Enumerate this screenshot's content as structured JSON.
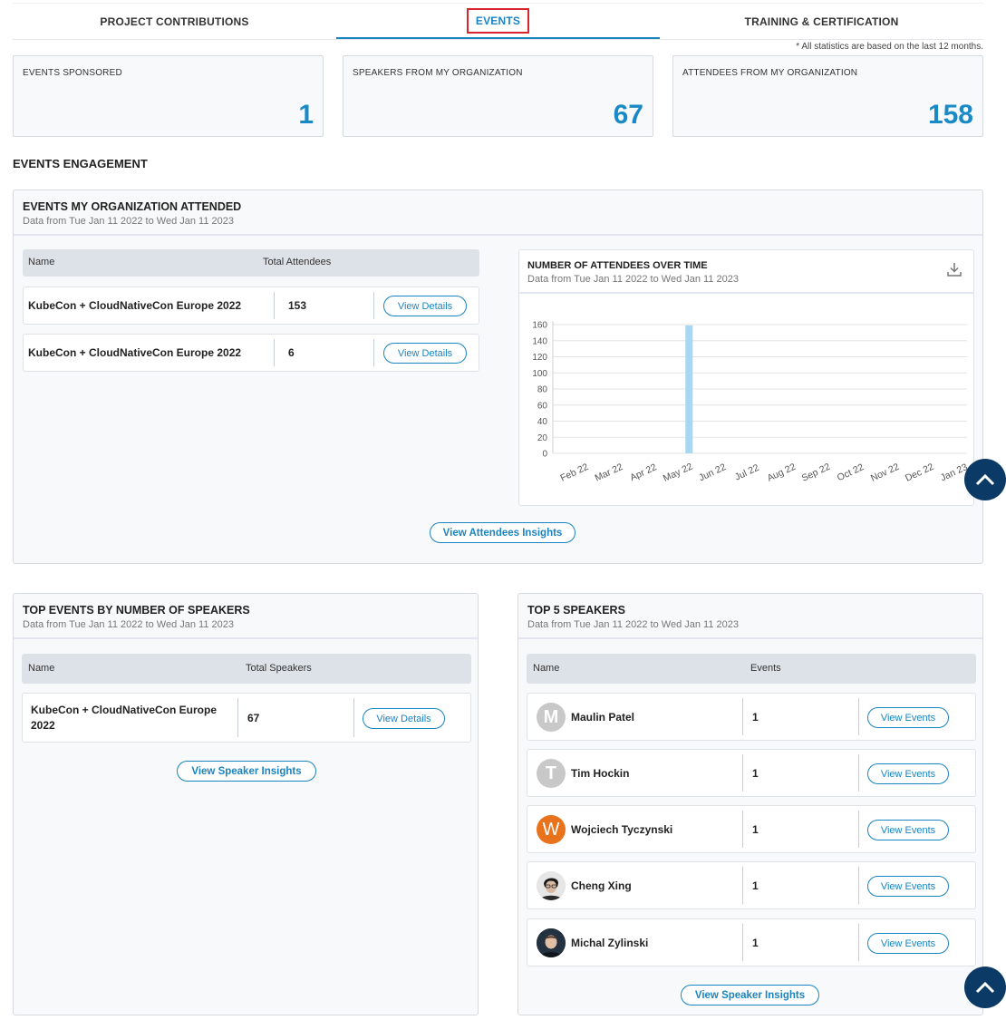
{
  "tabs": [
    {
      "label": "PROJECT CONTRIBUTIONS"
    },
    {
      "label": "EVENTS"
    },
    {
      "label": "TRAINING & CERTIFICATION"
    }
  ],
  "footnote": "* All statistics are based on the last 12 months.",
  "stats": [
    {
      "label": "EVENTS SPONSORED",
      "value": "1"
    },
    {
      "label": "SPEAKERS FROM MY ORGANIZATION",
      "value": "67"
    },
    {
      "label": "ATTENDEES FROM MY ORGANIZATION",
      "value": "158"
    }
  ],
  "section_title": "EVENTS ENGAGEMENT",
  "attended": {
    "title": "EVENTS MY ORGANIZATION ATTENDED",
    "subtitle": "Data from Tue Jan 11 2022 to Wed Jan 11 2023",
    "col_name": "Name",
    "col_total": "Total Attendees",
    "rows": [
      {
        "name": "KubeCon + CloudNativeCon Europe 2022",
        "count": "153",
        "action": "View Details"
      },
      {
        "name": "KubeCon + CloudNativeCon Europe 2022",
        "count": "6",
        "action": "View Details"
      }
    ],
    "insights_label": "View Attendees Insights"
  },
  "chart": {
    "title": "NUMBER OF ATTENDEES OVER TIME",
    "subtitle": "Data from Tue Jan 11 2022 to Wed Jan 11 2023"
  },
  "chart_data": {
    "type": "bar",
    "title": "NUMBER OF ATTENDEES OVER TIME",
    "categories": [
      "Feb 22",
      "Mar 22",
      "Apr 22",
      "May 22",
      "Jun 22",
      "Jul 22",
      "Aug 22",
      "Sep 22",
      "Oct 22",
      "Nov 22",
      "Dec 22",
      "Jan 23"
    ],
    "values": [
      0,
      0,
      0,
      159,
      0,
      0,
      0,
      0,
      0,
      0,
      0,
      0
    ],
    "yticks": [
      0,
      20,
      40,
      60,
      80,
      100,
      120,
      140,
      160
    ],
    "ylim": [
      0,
      160
    ],
    "grid": true,
    "bar_color": "#a7d7f2"
  },
  "top_events": {
    "title": "TOP EVENTS BY NUMBER OF SPEAKERS",
    "subtitle": "Data from Tue Jan 11 2022 to Wed Jan 11 2023",
    "col_name": "Name",
    "col_total": "Total Speakers",
    "rows": [
      {
        "name": "KubeCon + CloudNativeCon Europe 2022",
        "count": "67",
        "action": "View Details"
      }
    ],
    "insights_label": "View Speaker Insights"
  },
  "top_speakers": {
    "title": "TOP 5 SPEAKERS",
    "subtitle": "Data from Tue Jan 11 2022 to Wed Jan 11 2023",
    "col_name": "Name",
    "col_events": "Events",
    "rows": [
      {
        "initial": "M",
        "name": "Maulin Patel",
        "events": "1",
        "action": "View Events"
      },
      {
        "initial": "T",
        "name": "Tim Hockin",
        "events": "1",
        "action": "View Events"
      },
      {
        "initial": "W",
        "name": "Wojciech Tyczynski",
        "events": "1",
        "action": "View Events"
      },
      {
        "initial": "",
        "name": "Cheng Xing",
        "events": "1",
        "action": "View Events"
      },
      {
        "initial": "",
        "name": "Michal Zylinski",
        "events": "1",
        "action": "View Events"
      }
    ],
    "insights_label": "View Speaker Insights"
  },
  "colors": {
    "accent": "#1a84c0",
    "stat_value": "#1a8ac6",
    "highlight_box": "#d9232e",
    "scroll_button": "#0c3a66",
    "avatar_grey": "#c8c8c8",
    "avatar_orange": "#e8731c"
  },
  "icons": {
    "download": "download-icon",
    "scroll_top": "chevron-up-icon"
  }
}
